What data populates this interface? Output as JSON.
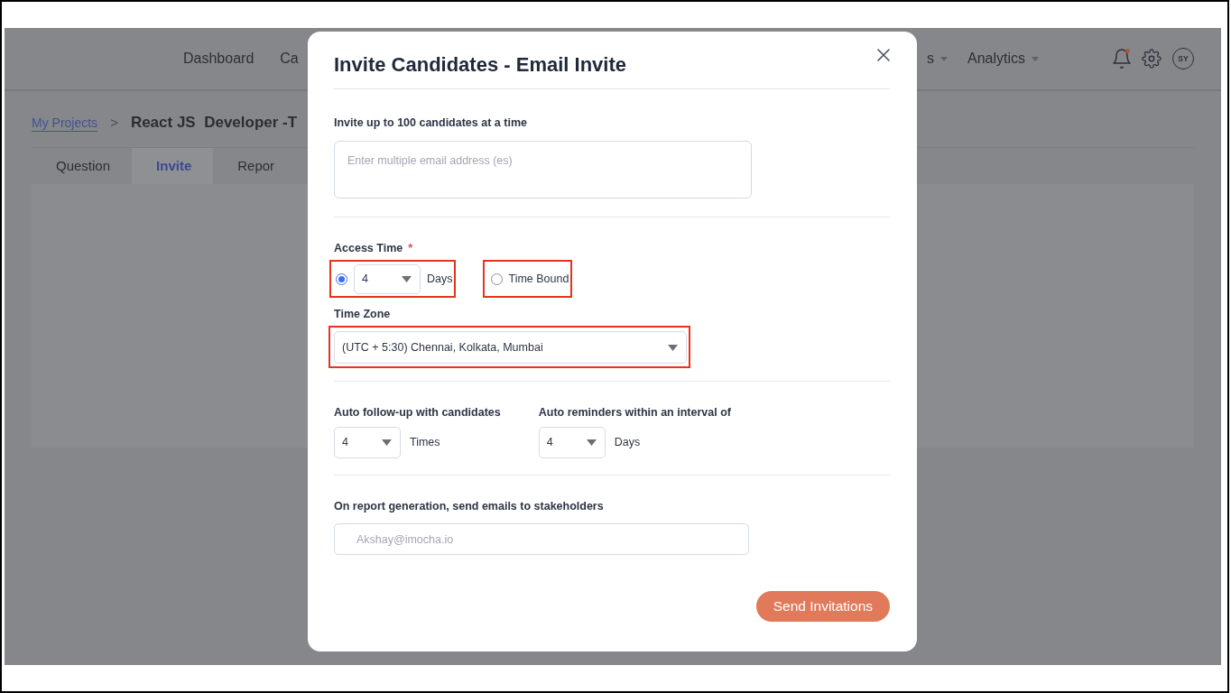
{
  "header": {
    "nav": [
      {
        "label": "Dashboard",
        "dropdown": false
      },
      {
        "label": "Ca",
        "dropdown": false
      },
      {
        "label": "s",
        "dropdown": true
      },
      {
        "label": "Analytics",
        "dropdown": true
      }
    ],
    "notifications_unread": true,
    "avatar": "SY"
  },
  "breadcrumb": {
    "link": "My Projects",
    "separator": ">",
    "current": "React JS  Developer -T"
  },
  "tabs": [
    {
      "label": "Question",
      "selected": false
    },
    {
      "label": "Invite",
      "selected": true
    },
    {
      "label": "Repor",
      "selected": false
    }
  ],
  "dialog": {
    "title": "Invite Candidates - Email Invite",
    "emails": {
      "label": "Invite up to 100 candidates at a time",
      "placeholder": "Enter multiple email address (es)"
    },
    "access_time": {
      "label": "Access Time",
      "required_mark": "*",
      "options": [
        {
          "kind": "duration",
          "selected": true,
          "value": "4",
          "unit": "Days",
          "highlighted": true
        },
        {
          "kind": "label",
          "selected": false,
          "label": "Time Bound",
          "highlighted": true
        }
      ]
    },
    "time_zone": {
      "label": "Time Zone",
      "value": "(UTC + 5:30) Chennai, Kolkata, Mumbai",
      "highlighted": true
    },
    "follow_up": {
      "label": "Auto follow-up with candidates",
      "value": "4",
      "unit": "Times"
    },
    "reminders": {
      "label": "Auto reminders within an interval of",
      "value": "4",
      "unit": "Days"
    },
    "stakeholders": {
      "label": "On report generation, send emails to stakeholders",
      "placeholder": "Akshay@imocha.io"
    },
    "submit": "Send Invitations"
  }
}
